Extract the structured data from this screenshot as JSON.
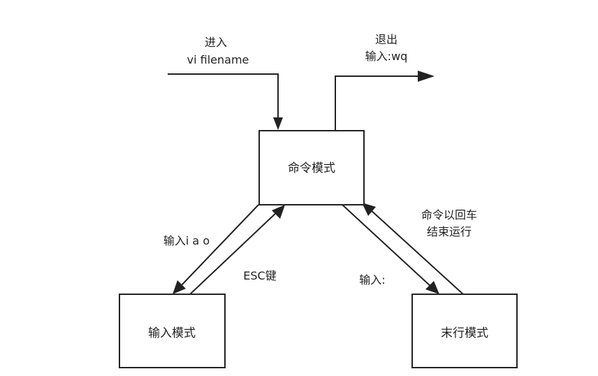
{
  "diagram": {
    "nodes": {
      "command_mode": "命令模式",
      "insert_mode": "输入模式",
      "lastline_mode": "末行模式"
    },
    "edges": {
      "enter_line1": "进入",
      "enter_line2": "vi filename",
      "exit_line1": "退出",
      "exit_line2": "输入:wq",
      "to_insert": "输入i a o",
      "to_command_esc": "ESC键",
      "to_lastline": "输入:",
      "to_command_line1": "命令以回车",
      "to_command_line2": "结束运行"
    },
    "colors": {
      "stroke": "#222222",
      "background": "#ffffff"
    }
  }
}
